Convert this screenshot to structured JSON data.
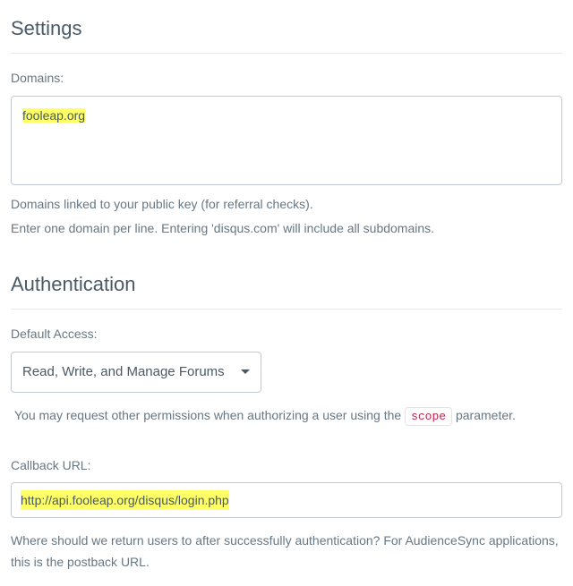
{
  "settings": {
    "heading": "Settings",
    "domains_label": "Domains:",
    "domains_value": "fooleap.org",
    "domains_help_line1": "Domains linked to your public key (for referral checks).",
    "domains_help_line2": "Enter one domain per line. Entering 'disqus.com' will include all subdomains."
  },
  "authentication": {
    "heading": "Authentication",
    "default_access_label": "Default Access:",
    "default_access_value": "Read, Write, and Manage Forums",
    "default_access_help_before": "You may request other permissions when authorizing a user using the",
    "scope_code": "scope",
    "default_access_help_after": " parameter.",
    "callback_label": "Callback URL:",
    "callback_value": "http://api.fooleap.org/disqus/login.php",
    "callback_help": "Where should we return users to after successfully authentication? For AudienceSync applications, this is the postback URL."
  }
}
